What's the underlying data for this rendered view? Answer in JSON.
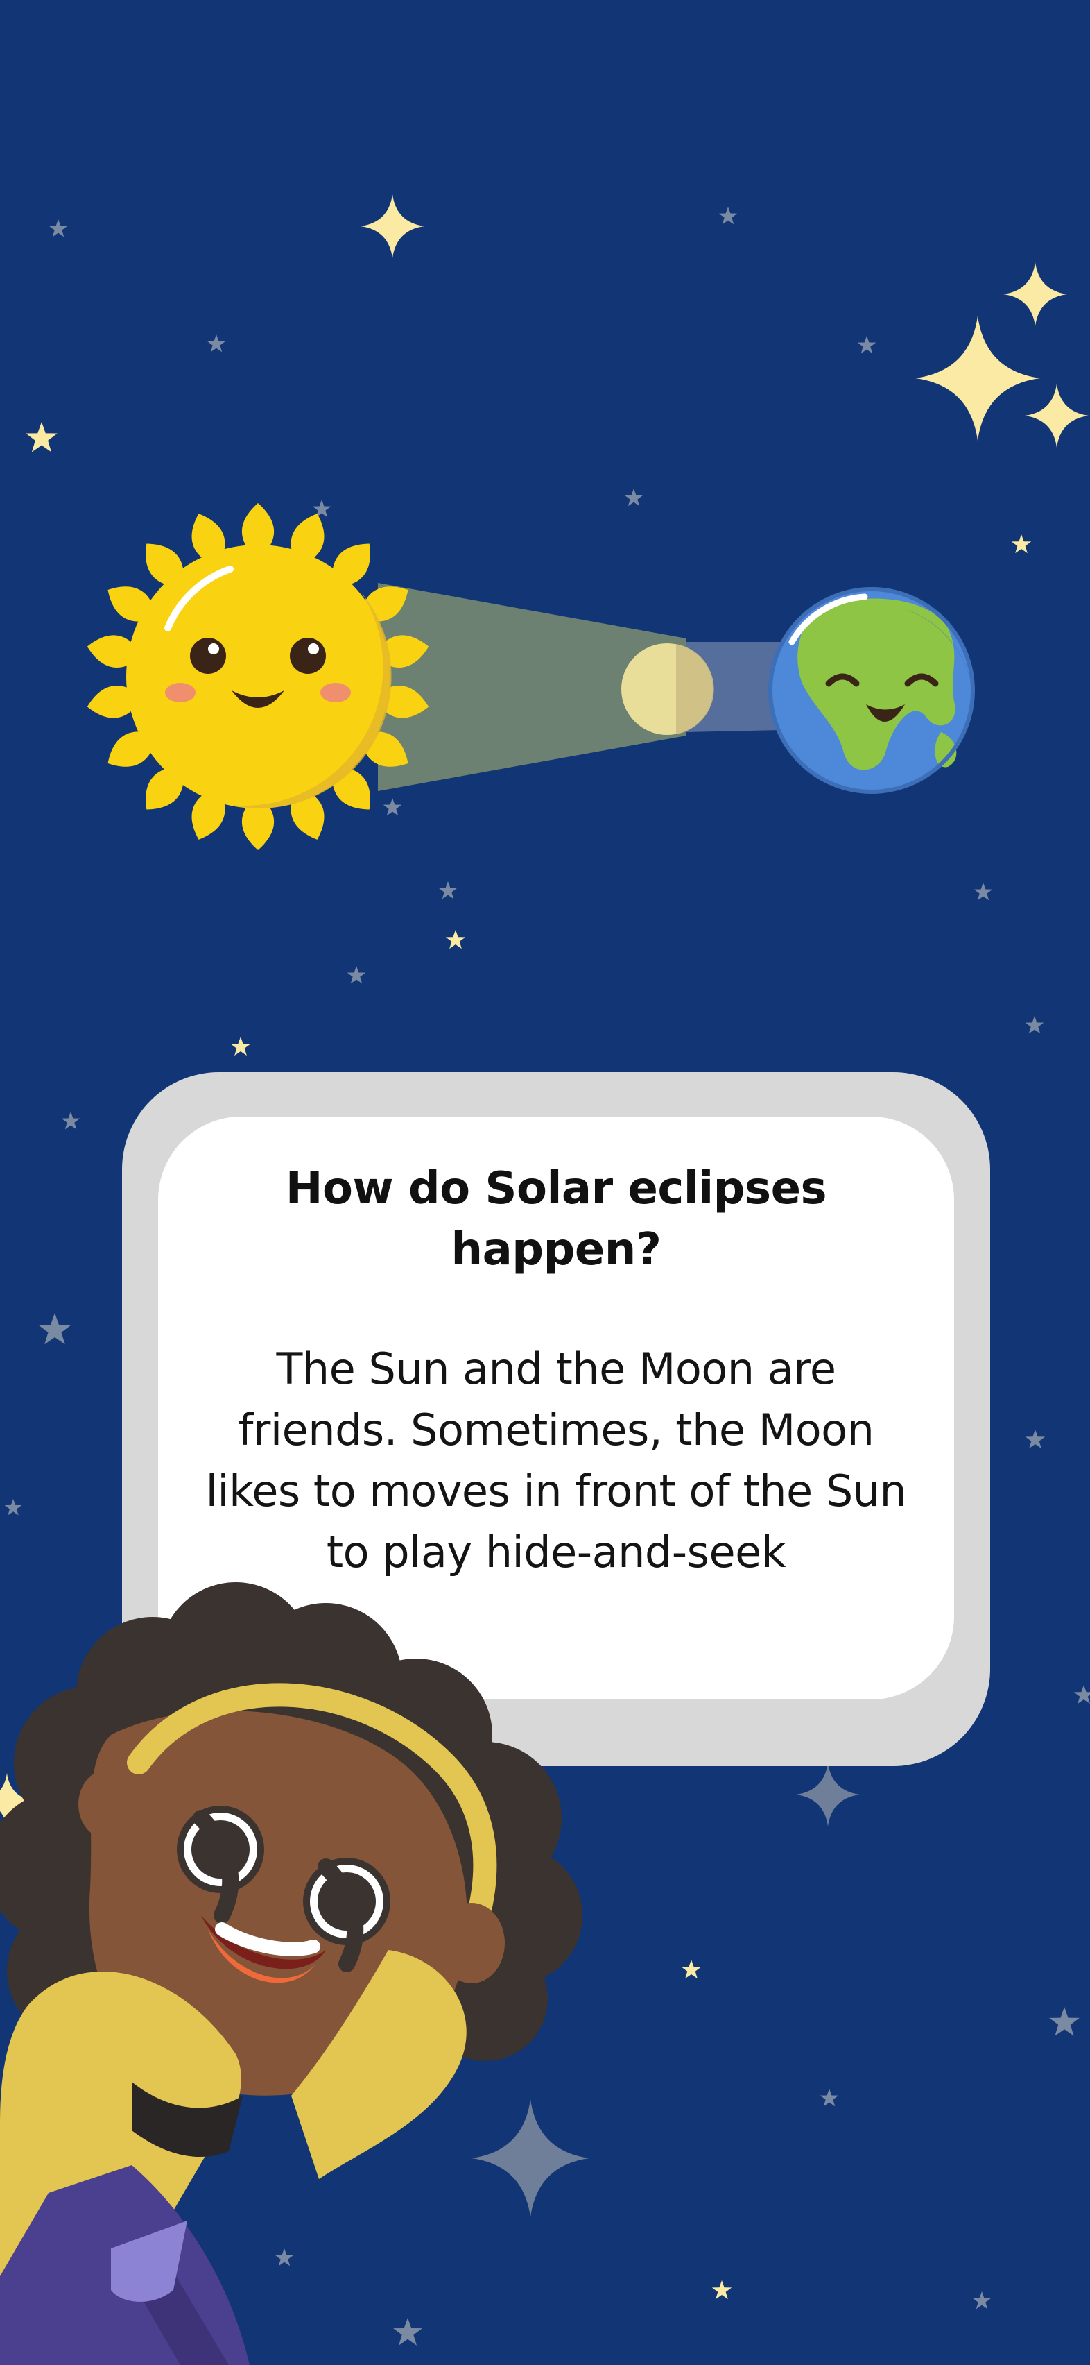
{
  "card": {
    "title": "How do  Solar eclipses happen?",
    "body": "The Sun and the Moon are friends. Sometimes, the Moon likes to moves in front of the Sun to play hide-and-seek"
  },
  "colors": {
    "background": "#113575",
    "sun": "#f9d312",
    "moon": "#e8de9a",
    "earth_ocean": "#4e88d8",
    "earth_land": "#8ec545",
    "card_frame": "#d8d8d8",
    "card_fill": "#ffffff"
  },
  "illustration": {
    "sun": "smiling-sun-icon",
    "moon": "moon-icon",
    "earth": "smiling-earth-icon",
    "girl": "surprised-girl-illustration",
    "stars": "star-icon"
  }
}
